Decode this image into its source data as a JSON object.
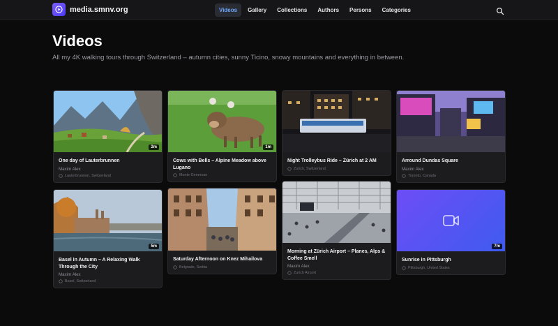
{
  "site": {
    "name": "media.smnv.org",
    "brand_color": "#6a4cff"
  },
  "nav": {
    "items": [
      {
        "label": "Videos",
        "active": true
      },
      {
        "label": "Gallery",
        "active": false
      },
      {
        "label": "Collections",
        "active": false
      },
      {
        "label": "Authors",
        "active": false
      },
      {
        "label": "Persons",
        "active": false
      },
      {
        "label": "Categories",
        "active": false
      }
    ],
    "search_icon": "search-icon"
  },
  "page": {
    "title": "Videos",
    "subtitle": "All my 4K walking tours through Switzerland – autumn cities, sunny Ticino, snowy mountains and everything in between."
  },
  "videos": [
    {
      "title": "One day of Lauterbrunnen",
      "author": "Maxim Alex",
      "location": "Lauterbrunnen, Switzerland",
      "duration": "2m"
    },
    {
      "title": "Cows with Bells – Alpine Meadow above Lugano",
      "author": "",
      "location": "Monte Generoso",
      "duration": "1m"
    },
    {
      "title": "Night Trolleybus Ride – Zürich at 2 AM",
      "author": "",
      "location": "Zurich, Switzerland",
      "duration": ""
    },
    {
      "title": "Arround Dundas Square",
      "author": "Maxim Alex",
      "location": "Toronto, Canada",
      "duration": ""
    },
    {
      "title": "Basel in Autumn – A Relaxing Walk Through the City",
      "author": "Maxim Alex",
      "location": "Basel, Switzerland",
      "duration": "5m"
    },
    {
      "title": "Saturday Afternoon on Knez Mihailova",
      "author": "",
      "location": "Belgrade, Serbia",
      "duration": ""
    },
    {
      "title": "Morning at Zürich Airport – Planes, Alps & Coffee Smell",
      "author": "Maxim Alex",
      "location": "Zurich Airport",
      "duration": ""
    },
    {
      "title": "Sunrise in Pittsburgh",
      "author": "",
      "location": "Pittsburgh, United States",
      "duration": "7m",
      "placeholder_icon": "video-camera-icon"
    }
  ]
}
